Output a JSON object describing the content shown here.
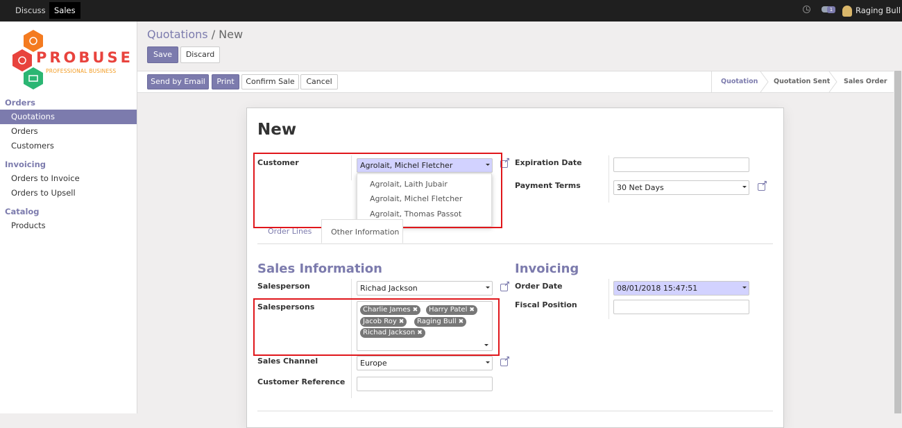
{
  "topbar": {
    "menus": [
      "Discuss",
      "Sales"
    ],
    "active_menu": "Sales",
    "chat_count": "1",
    "user_name": "Raging Bull"
  },
  "logo": {
    "brand": "PROBUSE",
    "tagline": "PROFESSIONAL BUSINESS"
  },
  "sidebar": {
    "sections": [
      {
        "title": "Orders",
        "items": [
          "Quotations",
          "Orders",
          "Customers"
        ]
      },
      {
        "title": "Invoicing",
        "items": [
          "Orders to Invoice",
          "Orders to Upsell"
        ]
      },
      {
        "title": "Catalog",
        "items": [
          "Products"
        ]
      }
    ],
    "active_item": "Quotations"
  },
  "breadcrumb": {
    "parent": "Quotations",
    "separator": "/",
    "current": "New"
  },
  "buttons": {
    "save": "Save",
    "discard": "Discard",
    "send_by_email": "Send by Email",
    "print": "Print",
    "confirm_sale": "Confirm Sale",
    "cancel": "Cancel"
  },
  "statusbar": {
    "stages": [
      "Quotation",
      "Quotation Sent",
      "Sales Order"
    ],
    "current": "Quotation"
  },
  "form": {
    "title": "New",
    "customer": {
      "label": "Customer",
      "value": "Agrolait, Michel Fletcher",
      "suggestions": [
        "Agrolait, Laith Jubair",
        "Agrolait, Michel Fletcher",
        "Agrolait, Thomas Passot"
      ]
    },
    "expiration_date": {
      "label": "Expiration Date",
      "value": ""
    },
    "payment_terms": {
      "label": "Payment Terms",
      "value": "30 Net Days"
    },
    "tabs": [
      "Order Lines",
      "Other Information"
    ],
    "active_tab": "Other Information",
    "sales_information": {
      "title": "Sales Information",
      "salesperson": {
        "label": "Salesperson",
        "value": "Richad Jackson"
      },
      "salespersons": {
        "label": "Salespersons",
        "tags": [
          "Charlie James",
          "Harry Patel",
          "Jacob Roy",
          "Raging Bull",
          "Richad Jackson"
        ]
      },
      "sales_channel": {
        "label": "Sales Channel",
        "value": "Europe"
      },
      "customer_reference": {
        "label": "Customer Reference",
        "value": ""
      }
    },
    "invoicing": {
      "title": "Invoicing",
      "order_date": {
        "label": "Order Date",
        "value": "08/01/2018 15:47:51"
      },
      "fiscal_position": {
        "label": "Fiscal Position",
        "value": ""
      }
    }
  },
  "colors": {
    "accent": "#7c7bad",
    "highlight_box": "#e0161b",
    "topbar": "#1f1f1f"
  }
}
